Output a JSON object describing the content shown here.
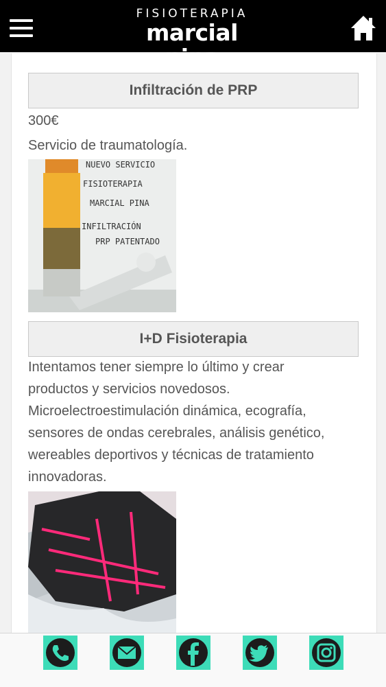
{
  "header": {
    "logo_small": "FISIOTERAPIA",
    "logo_big": "marcial pina",
    "menu_icon": "hamburger-menu-icon",
    "home_icon": "home-icon"
  },
  "sections": [
    {
      "title": "Infiltración de PRP",
      "price": "300€",
      "description": "Servicio de traumatología.",
      "image_text": [
        "NUEVO SERVICIO",
        "FISIOTERAPIA",
        "MARCIAL PINA",
        "INFILTRACIÓN",
        "PRP PATENTADO"
      ]
    },
    {
      "title": "I+D Fisioterapia",
      "description_lines": [
        "Intentamos tener siempre lo último y crear",
        "productos y servicios novedosos.",
        "Microelectroestimulación dinámica, ecografía,",
        "sensores de ondas cerebrales, análisis genético,",
        "wereables deportivos y técnicas de tratamiento",
        "innovadoras."
      ]
    }
  ],
  "footer": {
    "icons": [
      "phone-icon",
      "mail-icon",
      "facebook-icon",
      "twitter-icon",
      "instagram-icon"
    ]
  },
  "colors": {
    "header_bg": "#000000",
    "social_accent": "#3ddcb8",
    "title_bg": "#efefef",
    "text": "#555555"
  }
}
